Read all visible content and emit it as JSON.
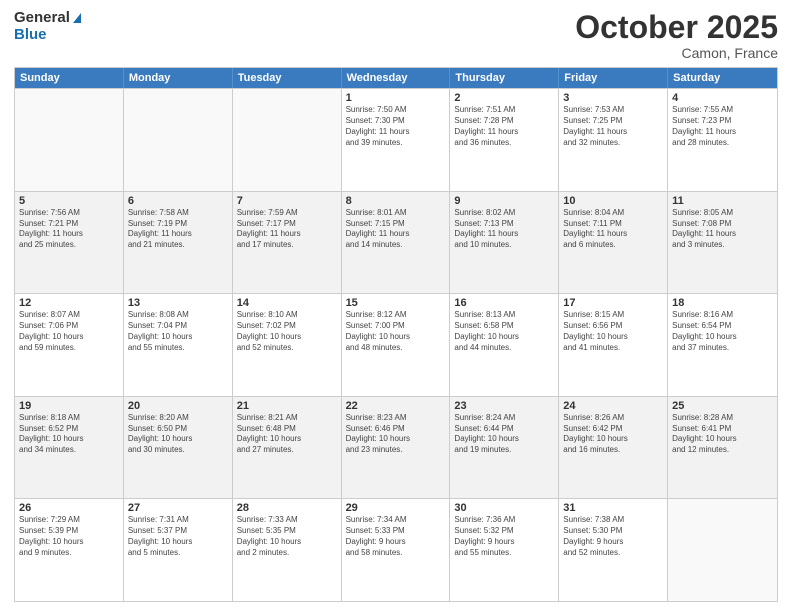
{
  "logo": {
    "line1": "General",
    "line2": "Blue"
  },
  "title": "October 2025",
  "location": "Camon, France",
  "days_of_week": [
    "Sunday",
    "Monday",
    "Tuesday",
    "Wednesday",
    "Thursday",
    "Friday",
    "Saturday"
  ],
  "rows": [
    [
      {
        "day": "",
        "lines": []
      },
      {
        "day": "",
        "lines": []
      },
      {
        "day": "",
        "lines": []
      },
      {
        "day": "1",
        "lines": [
          "Sunrise: 7:50 AM",
          "Sunset: 7:30 PM",
          "Daylight: 11 hours",
          "and 39 minutes."
        ]
      },
      {
        "day": "2",
        "lines": [
          "Sunrise: 7:51 AM",
          "Sunset: 7:28 PM",
          "Daylight: 11 hours",
          "and 36 minutes."
        ]
      },
      {
        "day": "3",
        "lines": [
          "Sunrise: 7:53 AM",
          "Sunset: 7:25 PM",
          "Daylight: 11 hours",
          "and 32 minutes."
        ]
      },
      {
        "day": "4",
        "lines": [
          "Sunrise: 7:55 AM",
          "Sunset: 7:23 PM",
          "Daylight: 11 hours",
          "and 28 minutes."
        ]
      }
    ],
    [
      {
        "day": "5",
        "lines": [
          "Sunrise: 7:56 AM",
          "Sunset: 7:21 PM",
          "Daylight: 11 hours",
          "and 25 minutes."
        ]
      },
      {
        "day": "6",
        "lines": [
          "Sunrise: 7:58 AM",
          "Sunset: 7:19 PM",
          "Daylight: 11 hours",
          "and 21 minutes."
        ]
      },
      {
        "day": "7",
        "lines": [
          "Sunrise: 7:59 AM",
          "Sunset: 7:17 PM",
          "Daylight: 11 hours",
          "and 17 minutes."
        ]
      },
      {
        "day": "8",
        "lines": [
          "Sunrise: 8:01 AM",
          "Sunset: 7:15 PM",
          "Daylight: 11 hours",
          "and 14 minutes."
        ]
      },
      {
        "day": "9",
        "lines": [
          "Sunrise: 8:02 AM",
          "Sunset: 7:13 PM",
          "Daylight: 11 hours",
          "and 10 minutes."
        ]
      },
      {
        "day": "10",
        "lines": [
          "Sunrise: 8:04 AM",
          "Sunset: 7:11 PM",
          "Daylight: 11 hours",
          "and 6 minutes."
        ]
      },
      {
        "day": "11",
        "lines": [
          "Sunrise: 8:05 AM",
          "Sunset: 7:08 PM",
          "Daylight: 11 hours",
          "and 3 minutes."
        ]
      }
    ],
    [
      {
        "day": "12",
        "lines": [
          "Sunrise: 8:07 AM",
          "Sunset: 7:06 PM",
          "Daylight: 10 hours",
          "and 59 minutes."
        ]
      },
      {
        "day": "13",
        "lines": [
          "Sunrise: 8:08 AM",
          "Sunset: 7:04 PM",
          "Daylight: 10 hours",
          "and 55 minutes."
        ]
      },
      {
        "day": "14",
        "lines": [
          "Sunrise: 8:10 AM",
          "Sunset: 7:02 PM",
          "Daylight: 10 hours",
          "and 52 minutes."
        ]
      },
      {
        "day": "15",
        "lines": [
          "Sunrise: 8:12 AM",
          "Sunset: 7:00 PM",
          "Daylight: 10 hours",
          "and 48 minutes."
        ]
      },
      {
        "day": "16",
        "lines": [
          "Sunrise: 8:13 AM",
          "Sunset: 6:58 PM",
          "Daylight: 10 hours",
          "and 44 minutes."
        ]
      },
      {
        "day": "17",
        "lines": [
          "Sunrise: 8:15 AM",
          "Sunset: 6:56 PM",
          "Daylight: 10 hours",
          "and 41 minutes."
        ]
      },
      {
        "day": "18",
        "lines": [
          "Sunrise: 8:16 AM",
          "Sunset: 6:54 PM",
          "Daylight: 10 hours",
          "and 37 minutes."
        ]
      }
    ],
    [
      {
        "day": "19",
        "lines": [
          "Sunrise: 8:18 AM",
          "Sunset: 6:52 PM",
          "Daylight: 10 hours",
          "and 34 minutes."
        ]
      },
      {
        "day": "20",
        "lines": [
          "Sunrise: 8:20 AM",
          "Sunset: 6:50 PM",
          "Daylight: 10 hours",
          "and 30 minutes."
        ]
      },
      {
        "day": "21",
        "lines": [
          "Sunrise: 8:21 AM",
          "Sunset: 6:48 PM",
          "Daylight: 10 hours",
          "and 27 minutes."
        ]
      },
      {
        "day": "22",
        "lines": [
          "Sunrise: 8:23 AM",
          "Sunset: 6:46 PM",
          "Daylight: 10 hours",
          "and 23 minutes."
        ]
      },
      {
        "day": "23",
        "lines": [
          "Sunrise: 8:24 AM",
          "Sunset: 6:44 PM",
          "Daylight: 10 hours",
          "and 19 minutes."
        ]
      },
      {
        "day": "24",
        "lines": [
          "Sunrise: 8:26 AM",
          "Sunset: 6:42 PM",
          "Daylight: 10 hours",
          "and 16 minutes."
        ]
      },
      {
        "day": "25",
        "lines": [
          "Sunrise: 8:28 AM",
          "Sunset: 6:41 PM",
          "Daylight: 10 hours",
          "and 12 minutes."
        ]
      }
    ],
    [
      {
        "day": "26",
        "lines": [
          "Sunrise: 7:29 AM",
          "Sunset: 5:39 PM",
          "Daylight: 10 hours",
          "and 9 minutes."
        ]
      },
      {
        "day": "27",
        "lines": [
          "Sunrise: 7:31 AM",
          "Sunset: 5:37 PM",
          "Daylight: 10 hours",
          "and 5 minutes."
        ]
      },
      {
        "day": "28",
        "lines": [
          "Sunrise: 7:33 AM",
          "Sunset: 5:35 PM",
          "Daylight: 10 hours",
          "and 2 minutes."
        ]
      },
      {
        "day": "29",
        "lines": [
          "Sunrise: 7:34 AM",
          "Sunset: 5:33 PM",
          "Daylight: 9 hours",
          "and 58 minutes."
        ]
      },
      {
        "day": "30",
        "lines": [
          "Sunrise: 7:36 AM",
          "Sunset: 5:32 PM",
          "Daylight: 9 hours",
          "and 55 minutes."
        ]
      },
      {
        "day": "31",
        "lines": [
          "Sunrise: 7:38 AM",
          "Sunset: 5:30 PM",
          "Daylight: 9 hours",
          "and 52 minutes."
        ]
      },
      {
        "day": "",
        "lines": []
      }
    ]
  ]
}
